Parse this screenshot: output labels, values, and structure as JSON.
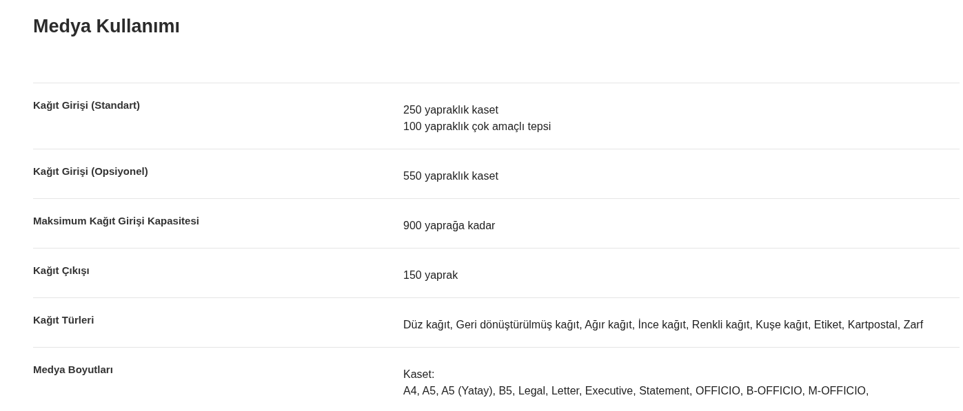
{
  "title": "Medya Kullanımı",
  "specs": [
    {
      "label": "Kağıt Girişi (Standart)",
      "lines": [
        "250 yapraklık kaset",
        "100 yapraklık çok amaçlı tepsi"
      ]
    },
    {
      "label": "Kağıt Girişi (Opsiyonel)",
      "lines": [
        "550 yapraklık kaset"
      ]
    },
    {
      "label": "Maksimum Kağıt Girişi Kapasitesi",
      "lines": [
        "900 yaprağa kadar"
      ]
    },
    {
      "label": "Kağıt Çıkışı",
      "lines": [
        "150 yaprak"
      ]
    },
    {
      "label": "Kağıt Türleri",
      "lines": [
        "Düz kağıt, Geri dönüştürülmüş kağıt, Ağır kağıt, İnce kağıt, Renkli kağıt, Kuşe kağıt, Etiket, Kartpostal, Zarf"
      ]
    },
    {
      "label": "Medya Boyutları",
      "lines": [
        "Kaset:",
        "A4, A5, A5 (Yatay), B5, Legal, Letter, Executive, Statement, OFFICIO, B-OFFICIO, M-OFFICIO,"
      ]
    }
  ]
}
